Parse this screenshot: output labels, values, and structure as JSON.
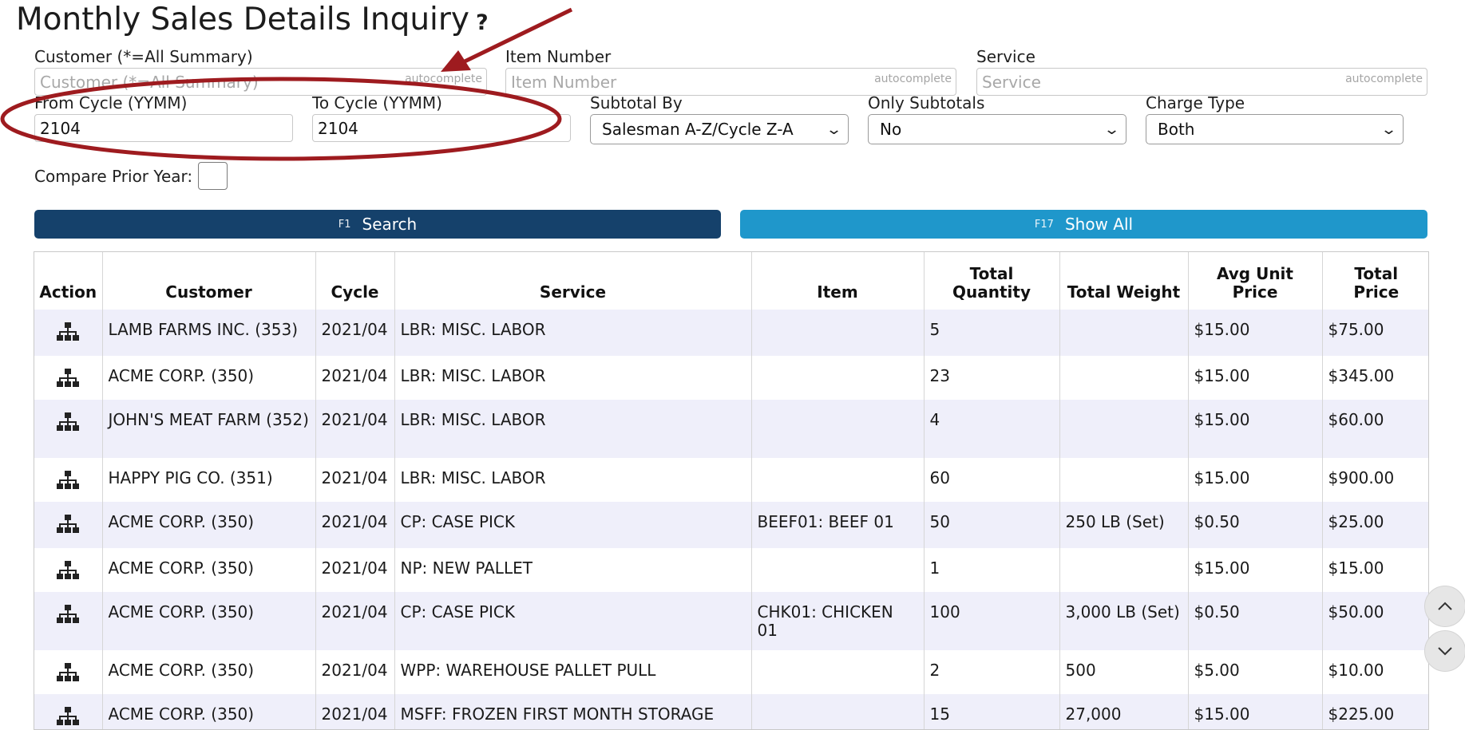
{
  "page": {
    "title": "Monthly Sales Details Inquiry",
    "help": "?"
  },
  "filters": {
    "customer": {
      "label": "Customer (*=All Summary)",
      "placeholder": "Customer (*=All Summary)",
      "value": "",
      "hint": "autocomplete"
    },
    "item_number": {
      "label": "Item Number",
      "placeholder": "Item Number",
      "value": "",
      "hint": "autocomplete"
    },
    "service": {
      "label": "Service",
      "placeholder": "Service",
      "value": "",
      "hint": "autocomplete"
    },
    "from_cycle": {
      "label": "From Cycle (YYMM)",
      "value": "2104"
    },
    "to_cycle": {
      "label": "To Cycle (YYMM)",
      "value": "2104"
    },
    "subtotal_by": {
      "label": "Subtotal By",
      "selected": "Salesman A-Z/Cycle Z-A"
    },
    "only_subtotals": {
      "label": "Only Subtotals",
      "selected": "No"
    },
    "charge_type": {
      "label": "Charge Type",
      "selected": "Both"
    },
    "compare_prior_year": {
      "label": "Compare Prior Year:",
      "checked": false
    }
  },
  "buttons": {
    "search": {
      "key": "F1",
      "label": "Search"
    },
    "show_all": {
      "key": "F17",
      "label": "Show All"
    }
  },
  "table": {
    "headers": {
      "action": "Action",
      "customer": "Customer",
      "cycle": "Cycle",
      "service": "Service",
      "item": "Item",
      "total_quantity": "Total Quantity",
      "total_weight": "Total Weight",
      "avg_unit_price": "Avg Unit Price",
      "total_price": "Total Price"
    },
    "rows": [
      {
        "customer": "LAMB FARMS INC. (353)",
        "cycle": "2021/04",
        "service": "LBR: MISC. LABOR",
        "item": "",
        "total_quantity": "5",
        "total_weight": "",
        "avg_unit_price": "$15.00",
        "total_price": "$75.00"
      },
      {
        "customer": "ACME CORP. (350)",
        "cycle": "2021/04",
        "service": "LBR: MISC. LABOR",
        "item": "",
        "total_quantity": "23",
        "total_weight": "",
        "avg_unit_price": "$15.00",
        "total_price": "$345.00"
      },
      {
        "customer": "JOHN'S MEAT FARM (352)",
        "cycle": "2021/04",
        "service": "LBR: MISC. LABOR",
        "item": "",
        "total_quantity": "4",
        "total_weight": "",
        "avg_unit_price": "$15.00",
        "total_price": "$60.00"
      },
      {
        "customer": "HAPPY PIG CO. (351)",
        "cycle": "2021/04",
        "service": "LBR: MISC. LABOR",
        "item": "",
        "total_quantity": "60",
        "total_weight": "",
        "avg_unit_price": "$15.00",
        "total_price": "$900.00"
      },
      {
        "customer": "ACME CORP. (350)",
        "cycle": "2021/04",
        "service": "CP: CASE PICK",
        "item": "BEEF01: BEEF 01",
        "total_quantity": "50",
        "total_weight": "250 LB (Set)",
        "avg_unit_price": "$0.50",
        "total_price": "$25.00"
      },
      {
        "customer": "ACME CORP. (350)",
        "cycle": "2021/04",
        "service": "NP: NEW PALLET",
        "item": "",
        "total_quantity": "1",
        "total_weight": "",
        "avg_unit_price": "$15.00",
        "total_price": "$15.00"
      },
      {
        "customer": "ACME CORP. (350)",
        "cycle": "2021/04",
        "service": "CP: CASE PICK",
        "item": "CHK01: CHICKEN 01",
        "total_quantity": "100",
        "total_weight": "3,000 LB (Set)",
        "avg_unit_price": "$0.50",
        "total_price": "$50.00"
      },
      {
        "customer": "ACME CORP. (350)",
        "cycle": "2021/04",
        "service": "WPP: WAREHOUSE PALLET PULL",
        "item": "",
        "total_quantity": "2",
        "total_weight": "500",
        "avg_unit_price": "$5.00",
        "total_price": "$10.00"
      },
      {
        "customer": "ACME CORP. (350)",
        "cycle": "2021/04",
        "service": "MSFF: FROZEN FIRST MONTH STORAGE",
        "item": "",
        "total_quantity": "15",
        "total_weight": "27,000",
        "avg_unit_price": "$15.00",
        "total_price": "$225.00"
      }
    ]
  },
  "icons": {
    "row_action": "hierarchy-icon",
    "scroll_up": "chevron-up-icon",
    "scroll_down": "chevron-down-icon"
  },
  "colors": {
    "search_button": "#15416b",
    "show_all_button": "#1f97cb",
    "annotation": "#9e1b1f",
    "row_stripe": "#efeffa"
  }
}
